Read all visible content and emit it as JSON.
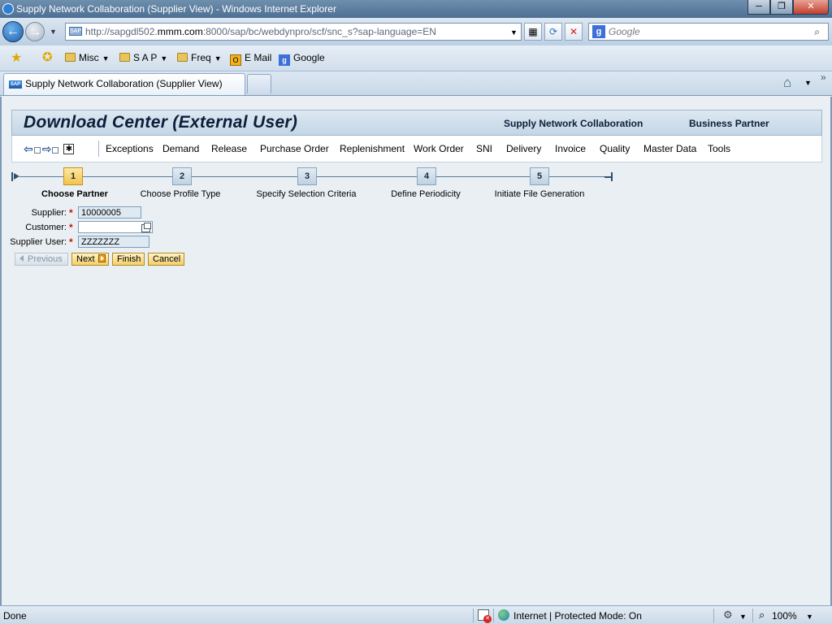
{
  "window": {
    "title": "Supply Network Collaboration (Supplier View) - Windows Internet Explorer",
    "minimize": "─",
    "maximize": "❐",
    "close": "✕"
  },
  "browser": {
    "address_prefix": "http://sapgdl502.",
    "address_host": "mmm.com",
    "address_suffix": ":8000/sap/bc/webdynpro/scf/snc_s?sap-language=EN",
    "search_placeholder": "Google",
    "favorites": [
      {
        "label": "Misc"
      },
      {
        "label": "S A P"
      },
      {
        "label": "Freq"
      },
      {
        "label": "E Mail"
      },
      {
        "label": "Google"
      }
    ],
    "tab_title": "Supply Network Collaboration (Supplier View)"
  },
  "header": {
    "title": "Download Center (External User)",
    "link_snc": "Supply Network Collaboration",
    "link_bp": "Business Partner"
  },
  "menu": {
    "items": [
      {
        "label": "Exceptions"
      },
      {
        "label": "Demand"
      },
      {
        "label": "Release"
      },
      {
        "label": "Purchase Order"
      },
      {
        "label": "Replenishment"
      },
      {
        "label": "Work Order"
      },
      {
        "label": "SNI"
      },
      {
        "label": "Delivery"
      },
      {
        "label": "Invoice"
      },
      {
        "label": "Quality"
      },
      {
        "label": "Master Data"
      },
      {
        "label": "Tools"
      }
    ]
  },
  "roadmap": {
    "steps": [
      {
        "num": "1",
        "label": "Choose Partner",
        "active": true
      },
      {
        "num": "2",
        "label": "Choose Profile Type",
        "active": false
      },
      {
        "num": "3",
        "label": "Specify Selection Criteria",
        "active": false
      },
      {
        "num": "4",
        "label": "Define Periodicity",
        "active": false
      },
      {
        "num": "5",
        "label": "Initiate File Generation",
        "active": false
      }
    ]
  },
  "form": {
    "supplier_label": "Supplier:",
    "supplier_value": "10000005",
    "customer_label": "Customer:",
    "customer_value": "",
    "user_label": "Supplier User:",
    "user_value": "ZZZZZZZ",
    "required_mark": "*"
  },
  "buttons": {
    "previous": "Previous",
    "next": "Next",
    "finish": "Finish",
    "cancel": "Cancel"
  },
  "status": {
    "done": "Done",
    "zone": "Internet | Protected Mode: On",
    "zoom": "100%"
  }
}
